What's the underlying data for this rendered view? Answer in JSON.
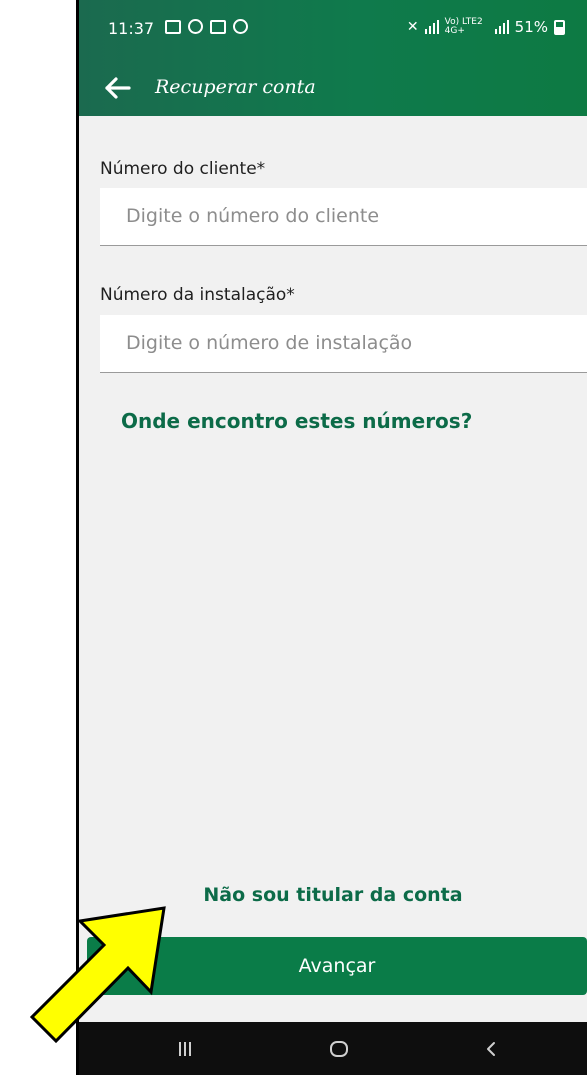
{
  "status_bar": {
    "time": "11:37",
    "network_label": "Vo) LTE2 4G+",
    "battery": "51%"
  },
  "app_bar": {
    "title": "Recuperar conta",
    "back_icon": "arrow-left-icon"
  },
  "form": {
    "client_number": {
      "label": "Número do cliente*",
      "placeholder": "Digite o número do cliente",
      "value": ""
    },
    "installation_number": {
      "label": "Número da instalação*",
      "placeholder": "Digite o número de instalação",
      "value": ""
    },
    "help_link": "Onde encontro estes números?"
  },
  "footer": {
    "not_holder_link": "Não sou titular da conta",
    "next_button": "Avançar"
  },
  "system_nav": {
    "recents_icon": "recents-icon",
    "home_icon": "home-icon",
    "back_icon": "back-chevron-icon"
  },
  "colors": {
    "primary_green": "#0a7c48",
    "link_green": "#0c6b48",
    "background": "#f1f1f1",
    "annotation_arrow": "#ffff00"
  }
}
